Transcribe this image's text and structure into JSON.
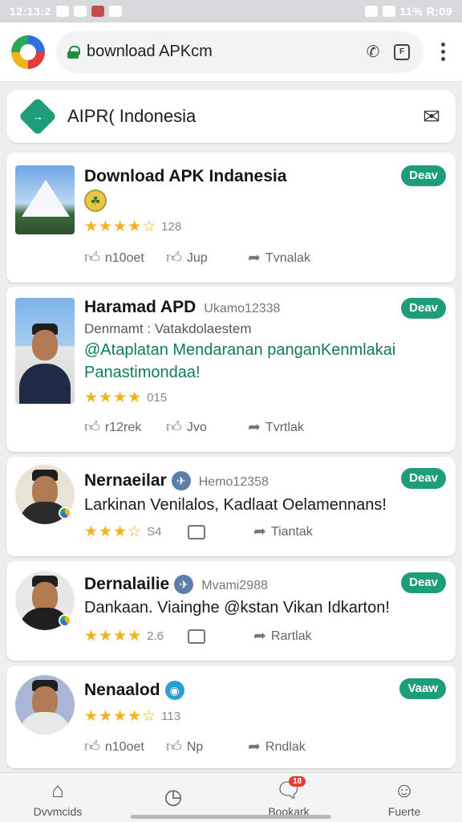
{
  "status_bar": {
    "left_text": "12:13:2",
    "right_text": "11% R:09"
  },
  "browser": {
    "url": "bownload APKcm",
    "menu": "more"
  },
  "site": {
    "title": "AIPR( Indonesia",
    "logo_glyph": "→"
  },
  "colors": {
    "accent": "#1d9d7a",
    "stars": "#f2b31a"
  },
  "cards": [
    {
      "title": "Download APK Indanesia",
      "badge": "Deav",
      "coin_glyph": "☘",
      "stars": "★★★★☆",
      "rating": "128",
      "actions": [
        "n10oet",
        "Jup",
        "Tvnalak"
      ]
    },
    {
      "title": "Haramad APD",
      "meta_id": "Ukamo12338",
      "badge": "Deav",
      "sub": "Denmamt : Vatakdolaestem",
      "desc": [
        "@Ataplatan Mendaranan panganKenmlakai",
        "Panastimondaa!"
      ],
      "stars": "★★★★",
      "rating": "015",
      "actions": [
        "r12rek",
        "Jvo",
        "Tvrtlak"
      ]
    },
    {
      "title": "Nernaeilar",
      "meta_id": "Hemo12358",
      "badge": "Deav",
      "desc": "Larkinan Venilalos, Kadlaat Oelamennans!",
      "stars": "★★★☆",
      "rating": "S4",
      "actions": [
        "Tiantak"
      ]
    },
    {
      "title": "Dernalailie",
      "meta_id": "Mvami2988",
      "badge": "Deav",
      "desc": "Dankaan. Viainghe @kstan Vikan Idkarton!",
      "stars": "★★★★",
      "rating": "2.6",
      "actions": [
        "Rartlak"
      ]
    },
    {
      "title": "Nenaalod",
      "badge": "Vaaw",
      "stars": "★★★★☆",
      "rating": "113",
      "actions": [
        "n10oet",
        "Np",
        "Rndlak"
      ]
    }
  ],
  "bottom_nav": [
    {
      "label": "Dvvmcids",
      "icon": "home-icon"
    },
    {
      "label": "",
      "icon": "compass-icon"
    },
    {
      "label": "Bookark",
      "icon": "chat-icon",
      "badge": "18"
    },
    {
      "label": "Fuerte",
      "icon": "profile-icon"
    }
  ]
}
